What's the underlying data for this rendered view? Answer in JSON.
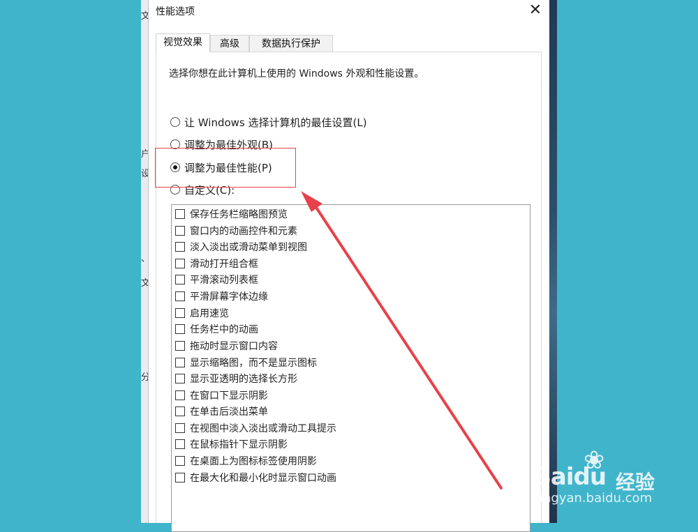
{
  "window": {
    "title": "性能选项",
    "close_glyph": "✕"
  },
  "background": {
    "left_fragments": [
      "文",
      "户",
      "设",
      "、",
      "文",
      "分"
    ]
  },
  "tabs": [
    {
      "label": "视觉效果",
      "active": true
    },
    {
      "label": "高级",
      "active": false
    },
    {
      "label": "数据执行保护",
      "active": false
    }
  ],
  "visual_effects": {
    "description": "选择你想在此计算机上使用的 Windows 外观和性能设置。",
    "options": [
      {
        "label": "让 Windows 选择计算机的最佳设置(L)",
        "checked": false
      },
      {
        "label": "调整为最佳外观(B)",
        "checked": false
      },
      {
        "label": "调整为最佳性能(P)",
        "checked": true
      },
      {
        "label": "自定义(C):",
        "checked": false
      }
    ],
    "effects": [
      "保存任务栏缩略图预览",
      "窗口内的动画控件和元素",
      "淡入淡出或滑动菜单到视图",
      "滑动打开组合框",
      "平滑滚动列表框",
      "平滑屏幕字体边缘",
      "启用速览",
      "任务栏中的动画",
      "拖动时显示窗口内容",
      "显示缩略图，而不是显示图标",
      "显示亚透明的选择长方形",
      "在窗口下显示阴影",
      "在单击后淡出菜单",
      "在视图中淡入淡出或滑动工具提示",
      "在鼠标指针下显示阴影",
      "在桌面上为图标标签使用阴影",
      "在最大化和最小化时显示窗口动画"
    ]
  },
  "annotation": {
    "color": "#e8414a"
  },
  "watermark": {
    "brand": "Bai",
    "brand_tail": "du",
    "cn": "经验",
    "url": "jingyan.baidu.com"
  }
}
